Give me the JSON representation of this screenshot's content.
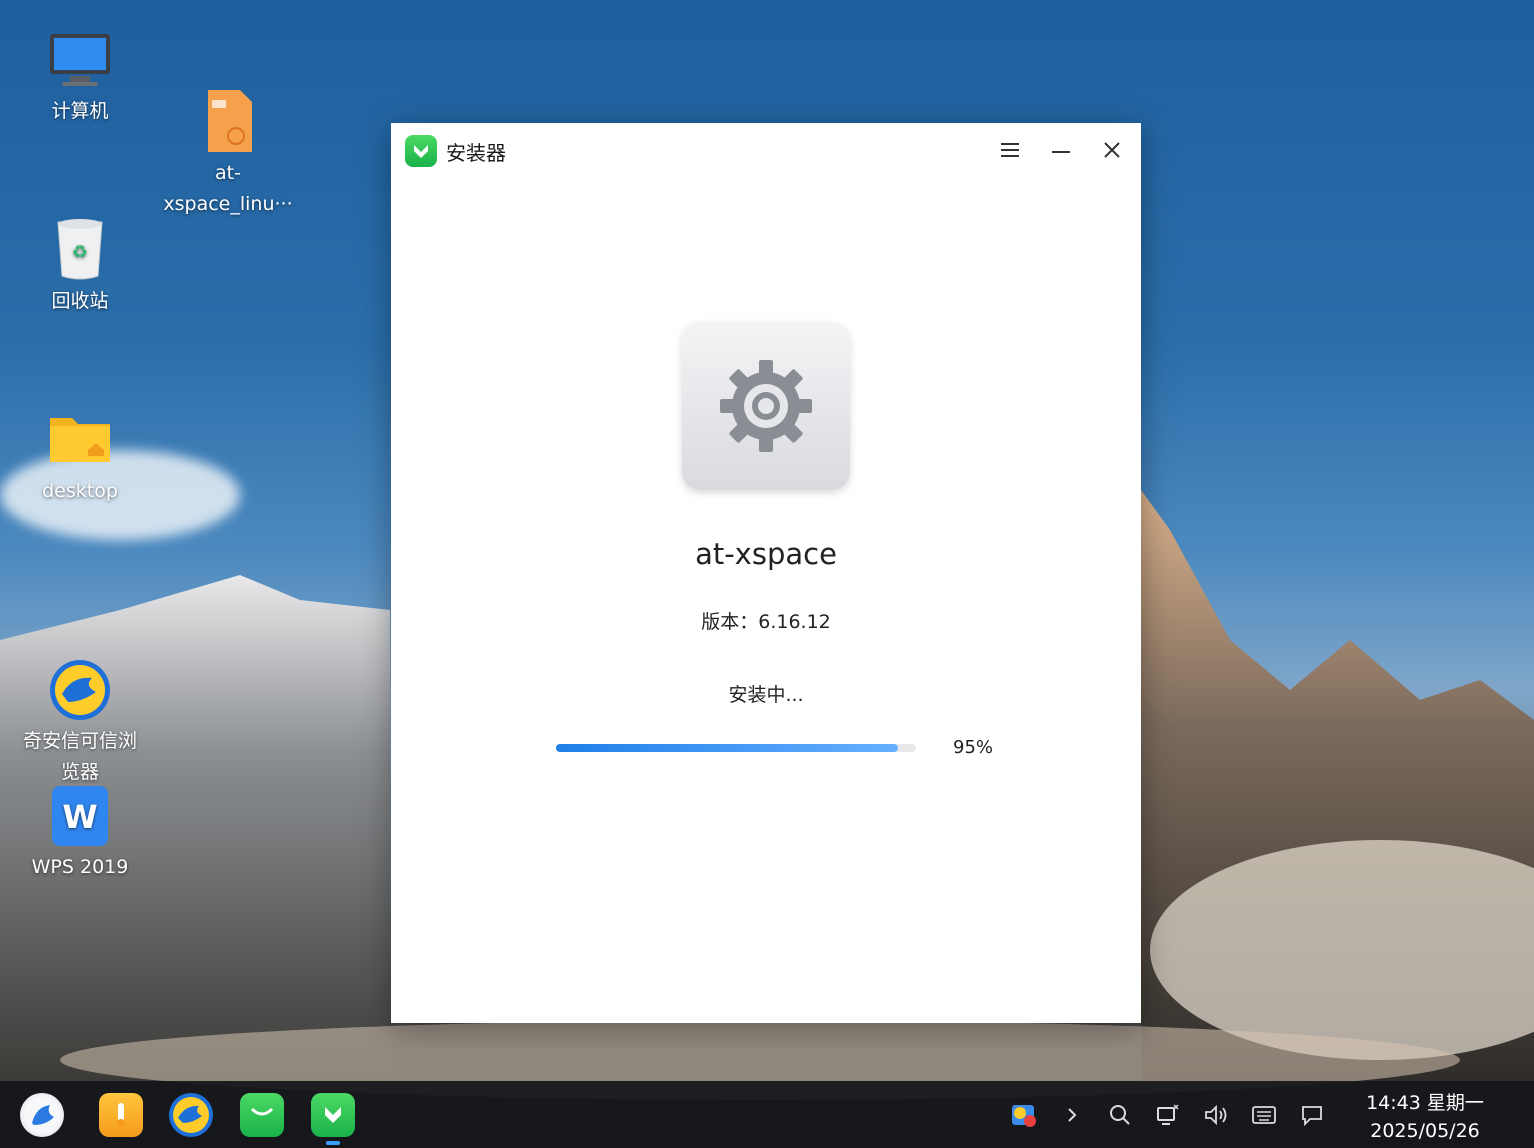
{
  "desktop": {
    "icons": [
      {
        "label": "计算机",
        "icon": "computer-icon"
      },
      {
        "label": "at-\nxspace_linu···",
        "icon": "deb-package-icon"
      },
      {
        "label": "回收站",
        "icon": "trash-icon"
      },
      {
        "label": "desktop",
        "icon": "home-folder-icon"
      },
      {
        "label": "奇安信可信浏\n览器",
        "icon": "qianxin-browser-icon"
      },
      {
        "label": "WPS 2019",
        "icon": "wps-icon"
      }
    ]
  },
  "window": {
    "title": "安装器",
    "package_name": "at-xspace",
    "version_text": "版本：6.16.12",
    "status_text": "安装中...",
    "progress_percent": 95,
    "progress_label": "95%",
    "accent_color": "#2b8af0"
  },
  "taskbar": {
    "apps": [
      "launcher-icon",
      "file-manager-icon",
      "browser-icon",
      "app-store-icon",
      "installer-icon"
    ],
    "tray": [
      "notification-app-icon",
      "chevron-right-icon",
      "search-icon",
      "network-icon",
      "volume-icon",
      "keyboard-icon",
      "message-icon"
    ],
    "clock_time": "14:43 星期一",
    "clock_date": "2025/05/26"
  }
}
